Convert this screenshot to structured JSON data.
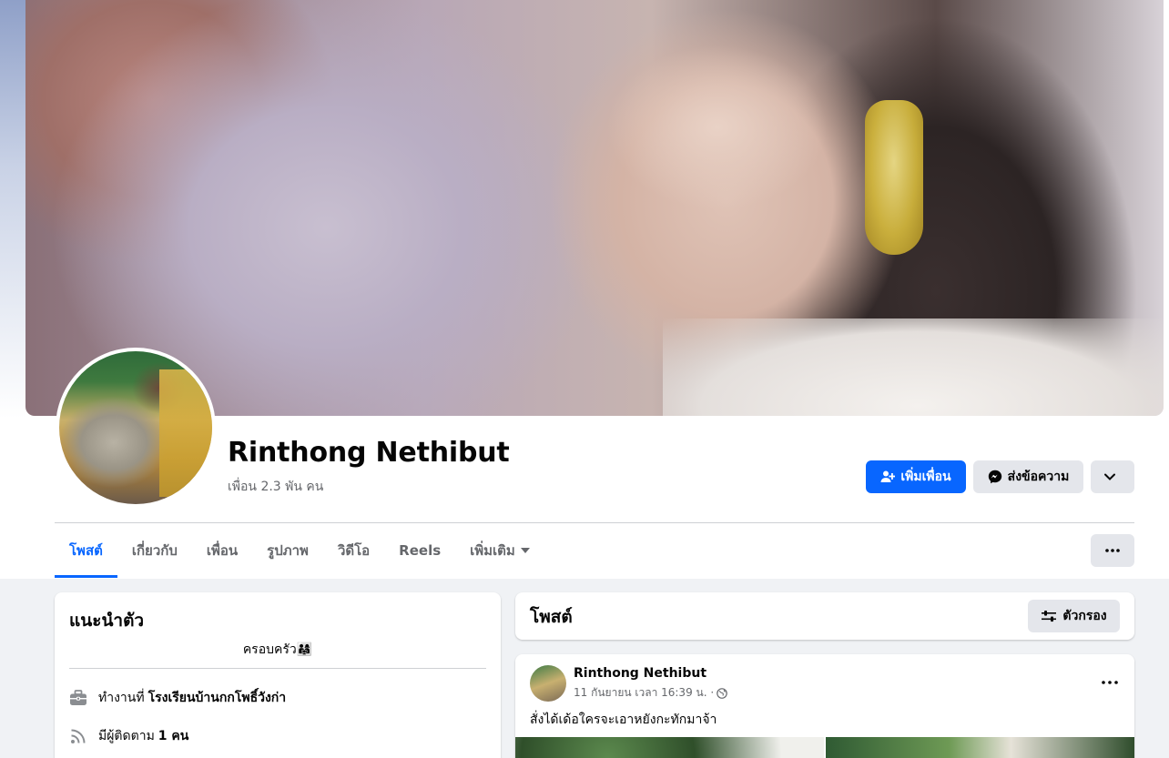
{
  "profile": {
    "name": "Rinthong Nethibut",
    "friends_count": "เพื่อน 2.3 พัน คน"
  },
  "actions": {
    "add_friend": "เพิ่มเพื่อน",
    "message": "ส่งข้อความ"
  },
  "tabs": [
    {
      "label": "โพสต์",
      "active": true
    },
    {
      "label": "เกี่ยวกับ"
    },
    {
      "label": "เพื่อน"
    },
    {
      "label": "รูปภาพ"
    },
    {
      "label": "วิดีโอ"
    },
    {
      "label": "Reels"
    },
    {
      "label": "เพิ่มเติม"
    }
  ],
  "intro": {
    "title": "แนะนำตัว",
    "bio": "ครอบครัว👨‍👩‍👧",
    "work_prefix": "ทำงานที่",
    "work_place": "โรงเรียนบ้านกกโพธิ์วังก่า",
    "followers_prefix": "มีผู้ติดตาม",
    "followers_count": "1 คน"
  },
  "posts_section": {
    "title": "โพสต์",
    "filter_label": "ตัวกรอง"
  },
  "post": {
    "author": "Rinthong Nethibut",
    "timestamp": "11 กันยายน เวลา 16:39 น. ·",
    "text": "สั่งได้เด้อใครจะเอาหยังกะทักมาจ้า"
  },
  "colors": {
    "accent": "#0866ff",
    "background": "#f0f2f5",
    "secondary_button": "#e4e6eb",
    "muted_text": "#65676b"
  }
}
